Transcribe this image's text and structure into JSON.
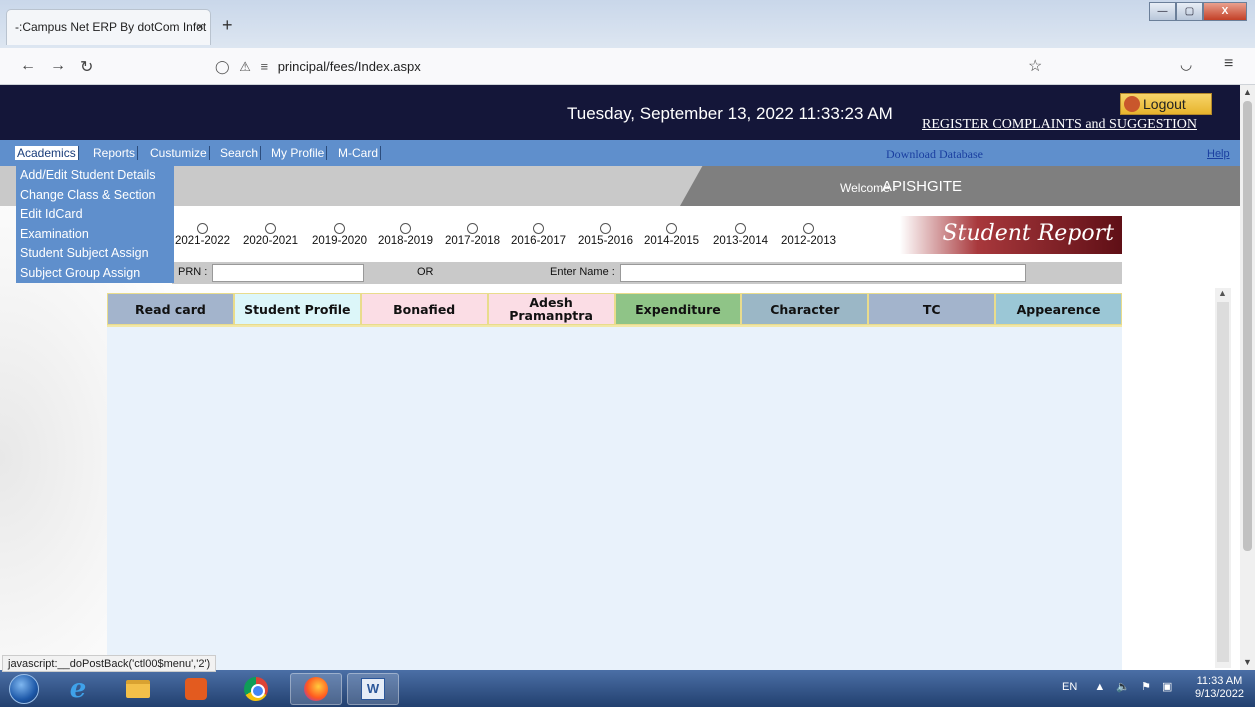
{
  "browser": {
    "tab_title": "-:Campus Net ERP By dotCom Infot",
    "tab_close": "×",
    "new_tab": "+",
    "url": "principal/fees/Index.aspx",
    "win_min": "—",
    "win_max": "▢",
    "win_close": "X"
  },
  "header": {
    "datetime": "Tuesday, September 13, 2022 11:33:23 AM",
    "logout": "Logout",
    "register": "REGISTER COMPLAINTS and SUGGESTION"
  },
  "menu": {
    "items": [
      "Academics",
      "Reports",
      "Custumize",
      "Search",
      "My Profile",
      "M-Card"
    ],
    "download": "Download Database",
    "help": "Help"
  },
  "dropdown": [
    "Add/Edit Student Details",
    "Change Class & Section",
    "Edit IdCard",
    "Examination",
    "Student Subject Assign",
    "Subject Group Assign"
  ],
  "welcome": {
    "label": "Welcome -",
    "name": "APISHGITE"
  },
  "years": [
    "2021-2022",
    "2020-2021",
    "2019-2020",
    "2018-2019",
    "2017-2018",
    "2016-2017",
    "2015-2016",
    "2014-2015",
    "2013-2014",
    "2012-2013"
  ],
  "student_report": "Student Report",
  "search": {
    "prn_label": "PRN :",
    "or": "OR",
    "name_label": "Enter Name :"
  },
  "tabs": [
    {
      "label": "Read card",
      "color": "#a3b4cc"
    },
    {
      "label": "Student Profile",
      "color": "#dcf6f9"
    },
    {
      "label": "Bonafied",
      "color": "#fbdde5"
    },
    {
      "label": "Adesh Pramanptra",
      "color": "#fbdde5"
    },
    {
      "label": "Expenditure",
      "color": "#8fc487"
    },
    {
      "label": "Character",
      "color": "#9bb7c6"
    },
    {
      "label": "TC",
      "color": "#a3b4cc"
    },
    {
      "label": "Appearence",
      "color": "#9bc7d6"
    }
  ],
  "status_text": "javascript:__doPostBack('ctl00$menu','2')",
  "taskbar": {
    "tray_lang": "EN",
    "time": "11:33 AM",
    "date": "9/13/2022"
  }
}
